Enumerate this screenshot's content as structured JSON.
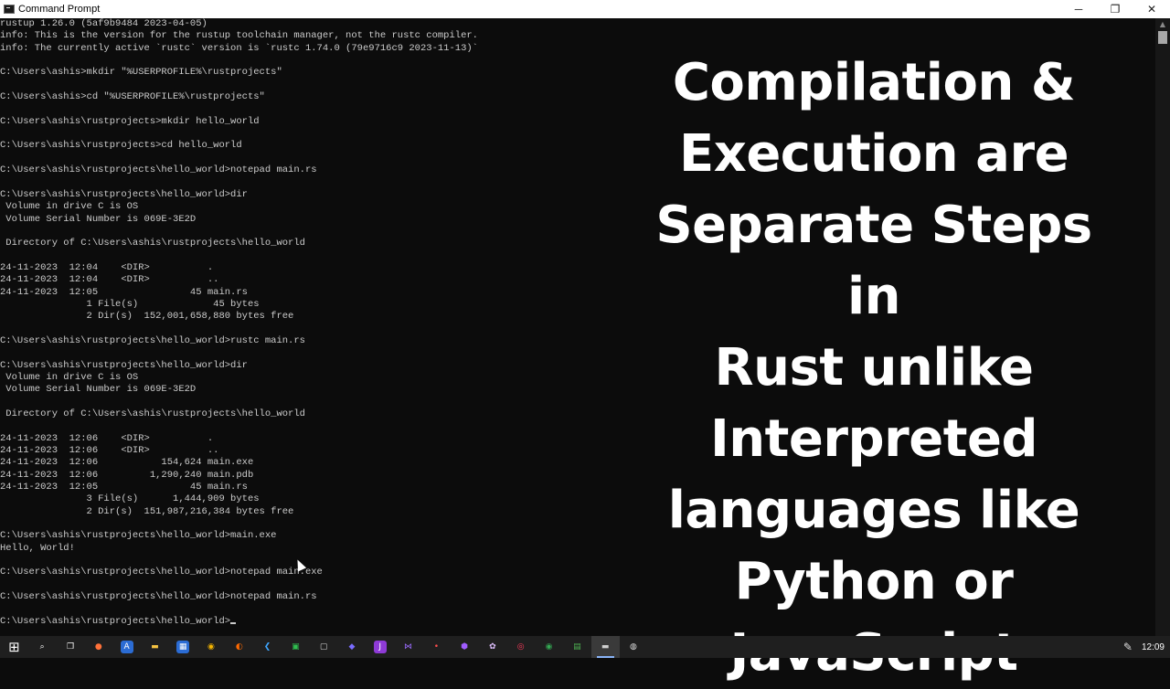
{
  "window": {
    "title": "Command Prompt",
    "minimize": "─",
    "restore": "❐",
    "close": "✕"
  },
  "console": {
    "lines": [
      "rustup 1.26.0 (5af9b9484 2023-04-05)",
      "info: This is the version for the rustup toolchain manager, not the rustc compiler.",
      "info: The currently active `rustc` version is `rustc 1.74.0 (79e9716c9 2023-11-13)`",
      "",
      "C:\\Users\\ashis>mkdir \"%USERPROFILE%\\rustprojects\"",
      "",
      "C:\\Users\\ashis>cd \"%USERPROFILE%\\rustprojects\"",
      "",
      "C:\\Users\\ashis\\rustprojects>mkdir hello_world",
      "",
      "C:\\Users\\ashis\\rustprojects>cd hello_world",
      "",
      "C:\\Users\\ashis\\rustprojects\\hello_world>notepad main.rs",
      "",
      "C:\\Users\\ashis\\rustprojects\\hello_world>dir",
      " Volume in drive C is OS",
      " Volume Serial Number is 069E-3E2D",
      "",
      " Directory of C:\\Users\\ashis\\rustprojects\\hello_world",
      "",
      "24-11-2023  12:04    <DIR>          .",
      "24-11-2023  12:04    <DIR>          ..",
      "24-11-2023  12:05                45 main.rs",
      "               1 File(s)             45 bytes",
      "               2 Dir(s)  152,001,658,880 bytes free",
      "",
      "C:\\Users\\ashis\\rustprojects\\hello_world>rustc main.rs",
      "",
      "C:\\Users\\ashis\\rustprojects\\hello_world>dir",
      " Volume in drive C is OS",
      " Volume Serial Number is 069E-3E2D",
      "",
      " Directory of C:\\Users\\ashis\\rustprojects\\hello_world",
      "",
      "24-11-2023  12:06    <DIR>          .",
      "24-11-2023  12:06    <DIR>          ..",
      "24-11-2023  12:06           154,624 main.exe",
      "24-11-2023  12:06         1,290,240 main.pdb",
      "24-11-2023  12:05                45 main.rs",
      "               3 File(s)      1,444,909 bytes",
      "               2 Dir(s)  151,987,216,384 bytes free",
      "",
      "C:\\Users\\ashis\\rustprojects\\hello_world>main.exe",
      "Hello, World!",
      "",
      "C:\\Users\\ashis\\rustprojects\\hello_world>notepad main.exe",
      "",
      "C:\\Users\\ashis\\rustprojects\\hello_world>notepad main.rs",
      "",
      "C:\\Users\\ashis\\rustprojects\\hello_world>"
    ]
  },
  "overlay": {
    "text": "Compilation &\nExecution are\nSeparate Steps in\nRust unlike\nInterpreted\nlanguages like\nPython or\nJavaScript"
  },
  "taskbar": {
    "icons": [
      {
        "name": "start-windows-icon",
        "glyph": "⊞",
        "color": "#ffffff",
        "bg": "transparent"
      },
      {
        "name": "search-icon",
        "glyph": "⌕",
        "color": "#ffffff",
        "bg": "transparent"
      },
      {
        "name": "task-view-icon",
        "glyph": "❒",
        "color": "#ffffff",
        "bg": "transparent"
      },
      {
        "name": "firefox-icon",
        "glyph": "●",
        "color": "#ff7139",
        "bg": "transparent"
      },
      {
        "name": "app-a-icon",
        "glyph": "A",
        "color": "#ffffff",
        "bg": "#2b6cd4"
      },
      {
        "name": "file-explorer-icon",
        "glyph": "▬",
        "color": "#f6c342",
        "bg": "transparent"
      },
      {
        "name": "store-icon",
        "glyph": "▦",
        "color": "#ffffff",
        "bg": "#2b6cd4"
      },
      {
        "name": "chrome-icon",
        "glyph": "◉",
        "color": "#f4b400",
        "bg": "transparent"
      },
      {
        "name": "app-orange-icon",
        "glyph": "◐",
        "color": "#ff6a00",
        "bg": "transparent"
      },
      {
        "name": "vscode-icon",
        "glyph": "❮",
        "color": "#3ea6ff",
        "bg": "transparent"
      },
      {
        "name": "app-green-icon",
        "glyph": "▣",
        "color": "#2fbf4f",
        "bg": "transparent"
      },
      {
        "name": "terminal-icon",
        "glyph": "▢",
        "color": "#cfcfcf",
        "bg": "transparent"
      },
      {
        "name": "app-purple-circle-icon",
        "glyph": "◆",
        "color": "#7a6cff",
        "bg": "transparent"
      },
      {
        "name": "jetbrains-icon",
        "glyph": "J",
        "color": "#ffffff",
        "bg": "#8e3ad6"
      },
      {
        "name": "visual-studio-icon",
        "glyph": "⋈",
        "color": "#9b6cff",
        "bg": "transparent"
      },
      {
        "name": "app-dot-icon",
        "glyph": "•",
        "color": "#ff4d4d",
        "bg": "transparent"
      },
      {
        "name": "app-hex-icon",
        "glyph": "⬢",
        "color": "#a05cff",
        "bg": "transparent"
      },
      {
        "name": "app-gear-icon",
        "glyph": "✿",
        "color": "#e0c0ff",
        "bg": "transparent"
      },
      {
        "name": "app-red-icon",
        "glyph": "◎",
        "color": "#ff3b5c",
        "bg": "transparent"
      },
      {
        "name": "chrome-alt-icon",
        "glyph": "◉",
        "color": "#34a853",
        "bg": "transparent"
      },
      {
        "name": "notepad-icon",
        "glyph": "▤",
        "color": "#4caf50",
        "bg": "transparent"
      },
      {
        "name": "command-prompt-icon",
        "glyph": "▬",
        "color": "#cfcfcf",
        "bg": "transparent",
        "active": true
      },
      {
        "name": "obs-icon",
        "glyph": "◍",
        "color": "#dddddd",
        "bg": "transparent"
      }
    ],
    "time": "12:09",
    "pen_glyph": "✎"
  }
}
